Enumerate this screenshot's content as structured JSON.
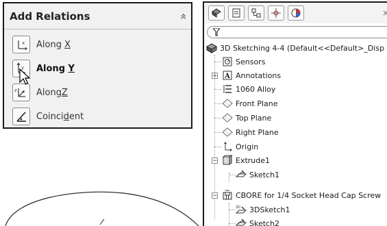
{
  "relations_panel": {
    "title": "Add Relations",
    "collapse_glyph": "«",
    "items": [
      {
        "label_pre": "Along ",
        "label_key": "X",
        "label_post": "",
        "icon": "along-x-icon",
        "bold": false
      },
      {
        "label_pre": "Along ",
        "label_key": "Y",
        "label_post": "",
        "icon": "along-y-icon",
        "bold": true
      },
      {
        "label_pre": "Along",
        "label_key": "Z",
        "label_post": "",
        "icon": "along-z-icon",
        "bold": false
      },
      {
        "label_pre": "Coinci",
        "label_key": "d",
        "label_post": "ent",
        "icon": "coincident-icon",
        "bold": false
      }
    ]
  },
  "feature_tree": {
    "close_glyph": "×",
    "root": "3D Sketching 4-4  (Default<<Default>_Disp",
    "items": [
      {
        "label": "Sensors"
      },
      {
        "label": "Annotations"
      },
      {
        "label": "1060 Alloy"
      },
      {
        "label": "Front Plane"
      },
      {
        "label": "Top Plane"
      },
      {
        "label": "Right Plane"
      },
      {
        "label": "Origin"
      },
      {
        "label": "Extrude1"
      },
      {
        "label": "Sketch1"
      },
      {
        "label": "CBORE for 1/4 Socket Head Cap Screw"
      },
      {
        "label": "3DSketch1"
      },
      {
        "label": "Sketch2"
      }
    ]
  },
  "colors": {
    "accent": "#1f3f7a",
    "tree_icon": "#333333",
    "plane_icon": "#6a6a6a"
  }
}
